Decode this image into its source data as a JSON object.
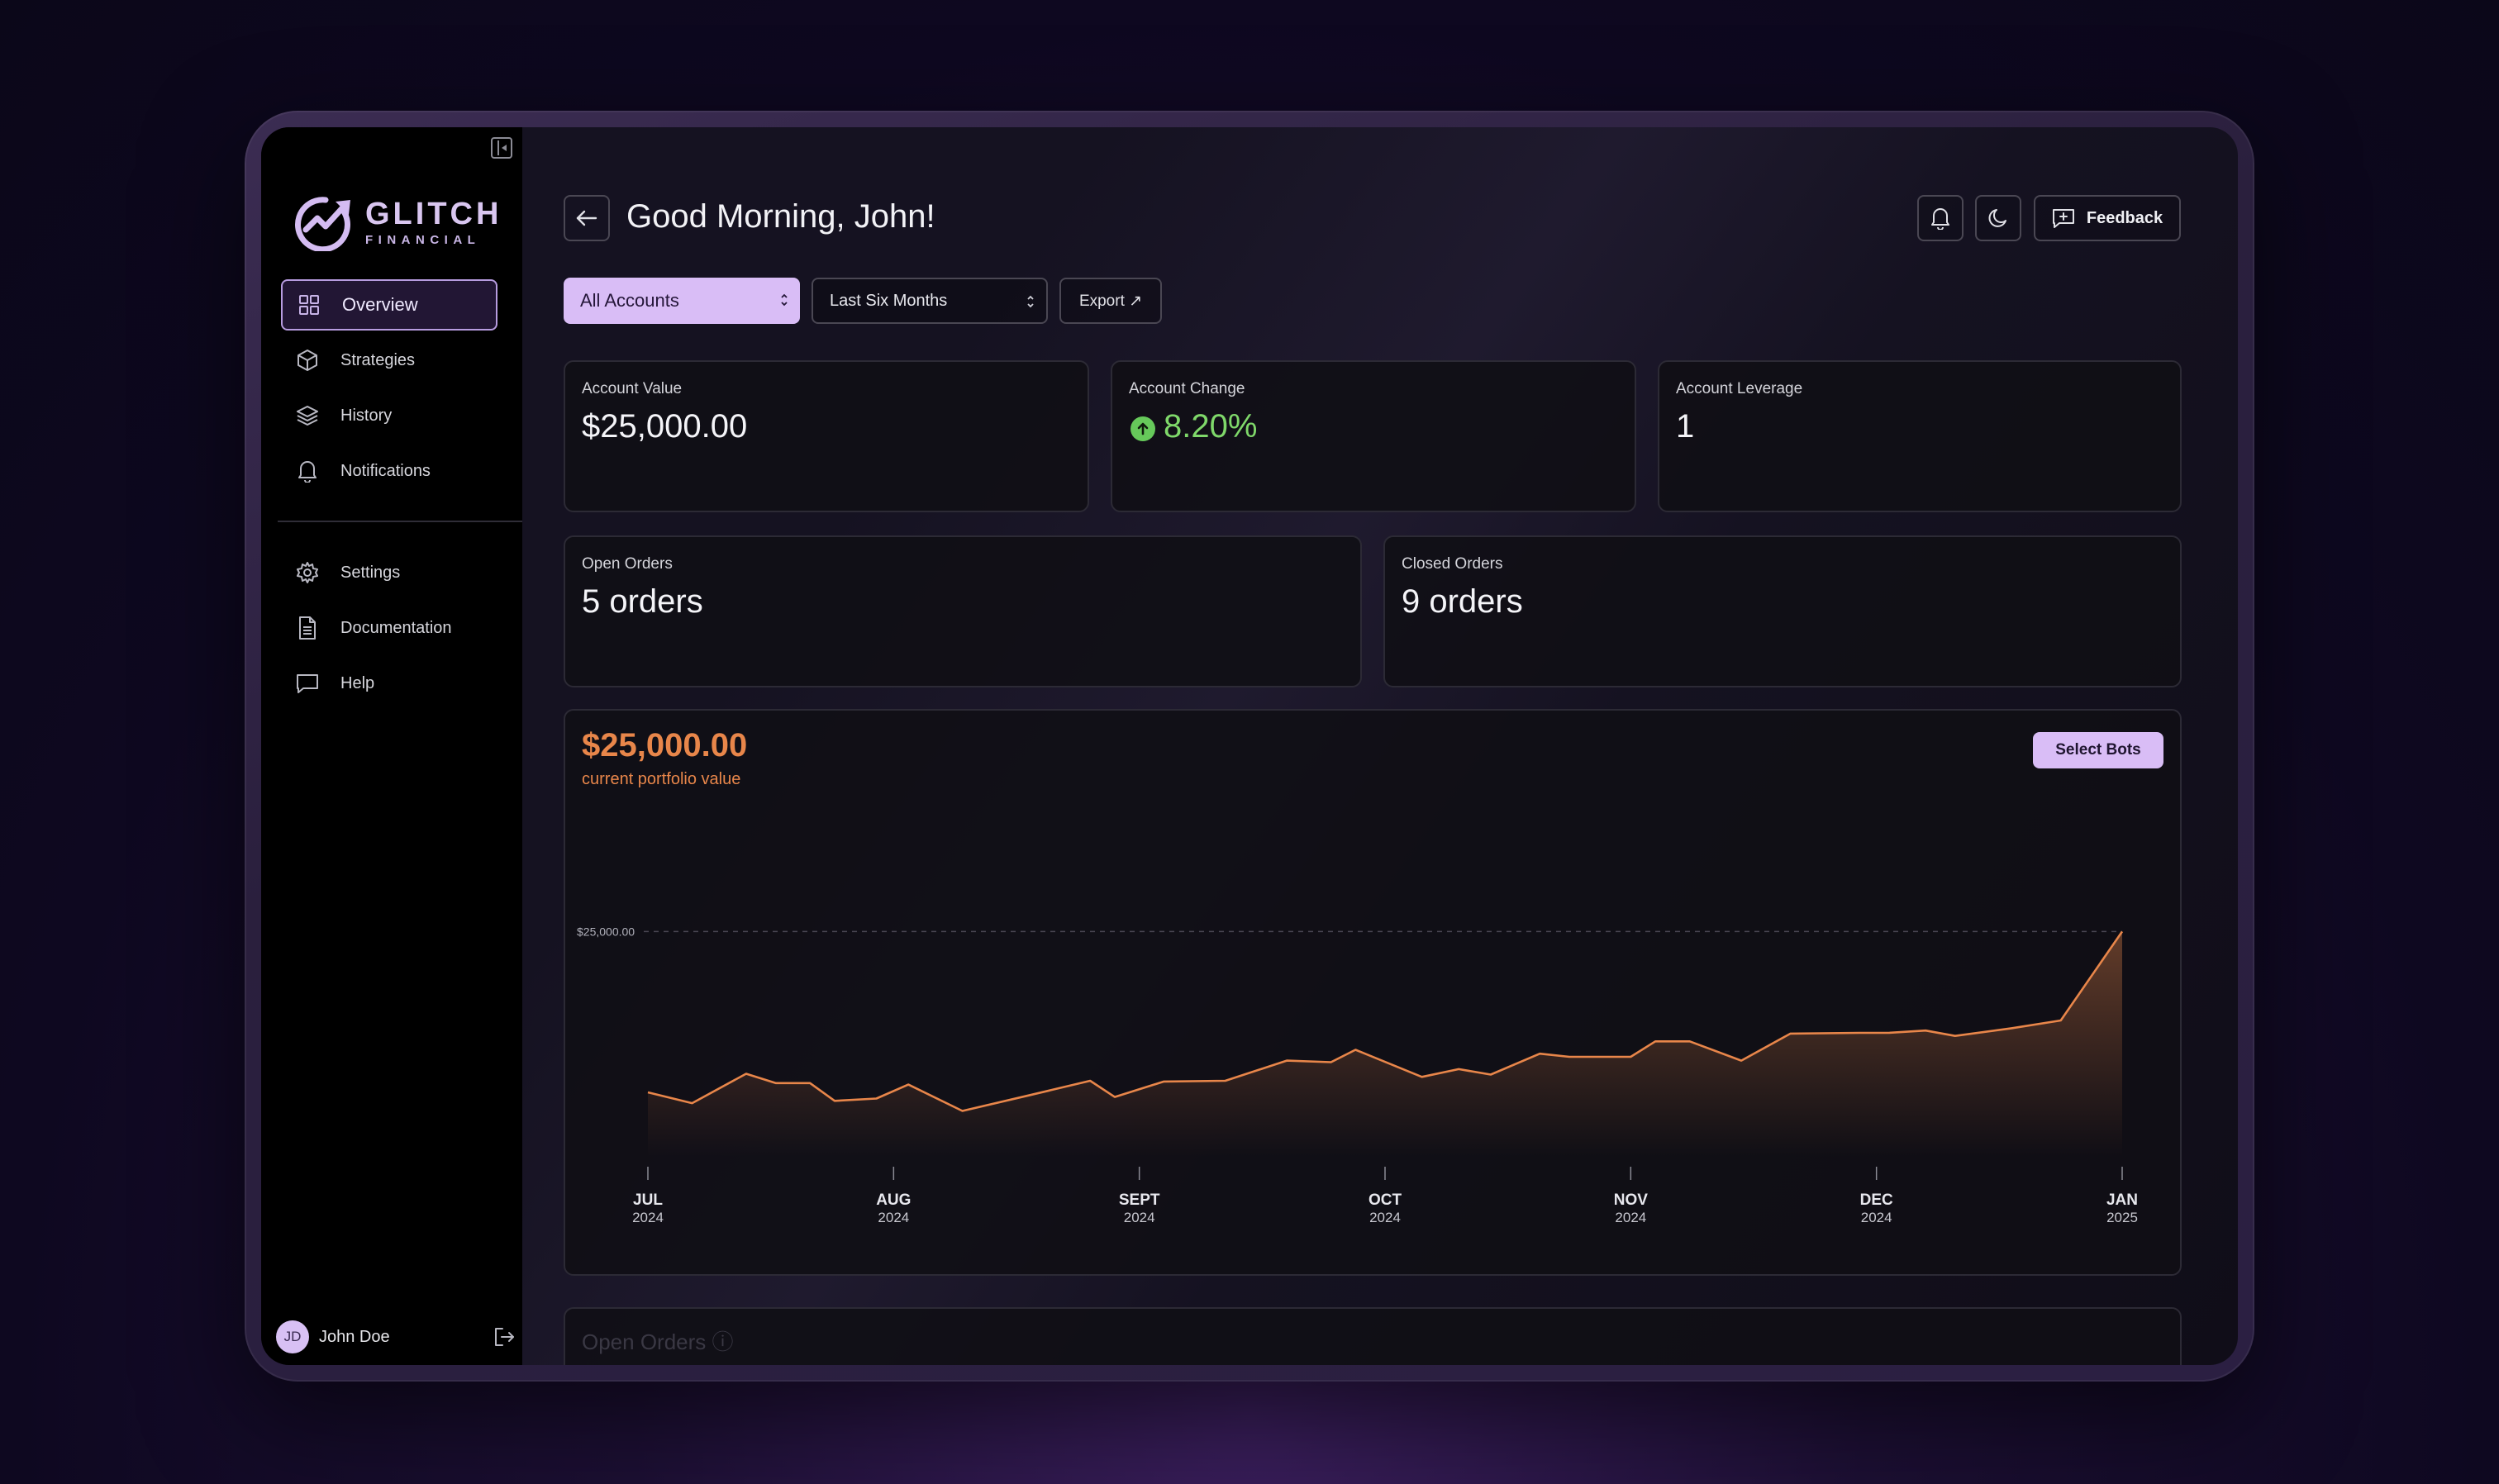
{
  "colors": {
    "accent": "#d9bdf6",
    "chart_line": "#e8864a",
    "positive": "#7fd86a",
    "background": "#151221"
  },
  "sidebar": {
    "logo_word": "GLITCH",
    "logo_sub": "FINANCIAL",
    "items": [
      {
        "label": "Overview",
        "icon": "grid-icon",
        "active": true
      },
      {
        "label": "Strategies",
        "icon": "cube-icon"
      },
      {
        "label": "History",
        "icon": "layers-icon"
      },
      {
        "label": "Notifications",
        "icon": "bell-icon"
      }
    ],
    "items2": [
      {
        "label": "Settings",
        "icon": "gear-icon"
      },
      {
        "label": "Documentation",
        "icon": "document-icon"
      },
      {
        "label": "Help",
        "icon": "chat-icon"
      }
    ],
    "user": {
      "initials": "JD",
      "name": "John Doe"
    }
  },
  "header": {
    "greeting": "Good Morning, John!",
    "feedback_label": "Feedback"
  },
  "filters": {
    "accounts": "All Accounts",
    "period": "Last Six Months",
    "export_label": "Export ↗"
  },
  "stats": {
    "account_value": {
      "label": "Account Value",
      "value": "$25,000.00"
    },
    "account_change": {
      "label": "Account Change",
      "value": "8.20%"
    },
    "account_leverage": {
      "label": "Account Leverage",
      "value": "1"
    },
    "open_orders": {
      "label": "Open Orders",
      "value": "5 orders"
    },
    "closed_orders": {
      "label": "Closed Orders",
      "value": "9 orders"
    }
  },
  "portfolio": {
    "value": "$25,000.00",
    "subtitle": "current portfolio value",
    "select_bots_label": "Select Bots"
  },
  "chart_data": {
    "type": "area",
    "title": "",
    "xlabel": "",
    "ylabel": "",
    "reference_line": {
      "value": 25000,
      "label": "$25,000.00"
    },
    "x_ticks": [
      {
        "month": "JUL",
        "year": "2024"
      },
      {
        "month": "AUG",
        "year": "2024"
      },
      {
        "month": "SEPT",
        "year": "2024"
      },
      {
        "month": "OCT",
        "year": "2024"
      },
      {
        "month": "NOV",
        "year": "2024"
      },
      {
        "month": "DEC",
        "year": "2024"
      },
      {
        "month": "JAN",
        "year": "2025"
      }
    ],
    "x_range": [
      0,
      6
    ],
    "ylim": [
      22300,
      25400
    ],
    "points": [
      [
        0.0,
        22920
      ],
      [
        0.18,
        22780
      ],
      [
        0.4,
        23160
      ],
      [
        0.52,
        23040
      ],
      [
        0.66,
        23040
      ],
      [
        0.76,
        22810
      ],
      [
        0.93,
        22840
      ],
      [
        1.06,
        23020
      ],
      [
        1.28,
        22680
      ],
      [
        1.55,
        22880
      ],
      [
        1.8,
        23070
      ],
      [
        1.9,
        22860
      ],
      [
        2.1,
        23060
      ],
      [
        2.35,
        23070
      ],
      [
        2.6,
        23330
      ],
      [
        2.78,
        23310
      ],
      [
        2.88,
        23470
      ],
      [
        3.15,
        23120
      ],
      [
        3.3,
        23220
      ],
      [
        3.43,
        23150
      ],
      [
        3.63,
        23420
      ],
      [
        3.75,
        23380
      ],
      [
        3.85,
        23380
      ],
      [
        4.0,
        23380
      ],
      [
        4.1,
        23580
      ],
      [
        4.24,
        23580
      ],
      [
        4.45,
        23330
      ],
      [
        4.65,
        23680
      ],
      [
        4.93,
        23690
      ],
      [
        5.05,
        23690
      ],
      [
        5.2,
        23720
      ],
      [
        5.32,
        23650
      ],
      [
        5.55,
        23750
      ],
      [
        5.75,
        23850
      ],
      [
        6.0,
        25000
      ]
    ]
  },
  "open_orders_section": {
    "title": "Open Orders ⓘ"
  }
}
